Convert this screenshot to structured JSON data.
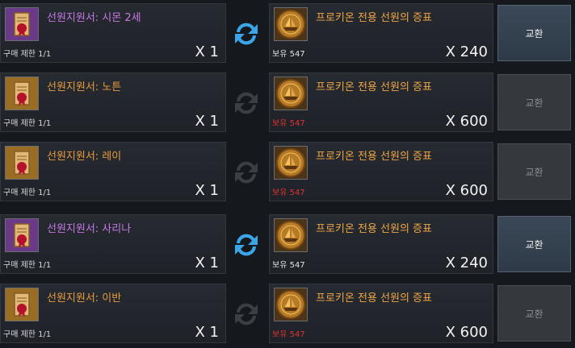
{
  "colors": {
    "purple_name": "#c678e6",
    "orange_name": "#e99b3c",
    "reward_name": "#f0a645",
    "insufficient": "#e0342e",
    "swap_active": "#3aa6e8",
    "swap_inactive": "#3a3f46"
  },
  "rows": [
    {
      "item": {
        "name": "선원지원서: 시몬 2세",
        "icon": "scroll-icon",
        "limit": "구매 제한 1/1",
        "qty": "X 1"
      },
      "swap": {
        "icon": "swap-arrows-icon",
        "active": true
      },
      "reward": {
        "name": "프로키온 전용 선원의 증표",
        "icon": "ship-coin-icon",
        "owned": "보유 547",
        "cost": "X 240",
        "sufficient": true
      },
      "button": {
        "label": "교환",
        "enabled": true
      }
    },
    {
      "item": {
        "name": "선원지원서: 노튼",
        "icon": "scroll-icon",
        "limit": "구매 제한 1/1",
        "qty": "X 1"
      },
      "swap": {
        "icon": "swap-arrows-icon",
        "active": false
      },
      "reward": {
        "name": "프로키온 전용 선원의 증표",
        "icon": "ship-coin-icon",
        "owned": "보유 547",
        "cost": "X 600",
        "sufficient": false
      },
      "button": {
        "label": "교환",
        "enabled": false
      }
    },
    {
      "item": {
        "name": "선원지원서: 레이",
        "icon": "scroll-icon",
        "limit": "구매 제한 1/1",
        "qty": "X 1"
      },
      "swap": {
        "icon": "swap-arrows-icon",
        "active": false
      },
      "reward": {
        "name": "프로키온 전용 선원의 증표",
        "icon": "ship-coin-icon",
        "owned": "보유 547",
        "cost": "X 600",
        "sufficient": false
      },
      "button": {
        "label": "교환",
        "enabled": false
      }
    },
    {
      "item": {
        "name": "선원지원서: 사리나",
        "icon": "scroll-icon",
        "limit": "구매 제한 1/1",
        "qty": "X 1"
      },
      "swap": {
        "icon": "swap-arrows-icon",
        "active": true
      },
      "reward": {
        "name": "프로키온 전용 선원의 증표",
        "icon": "ship-coin-icon",
        "owned": "보유 547",
        "cost": "X 240",
        "sufficient": true
      },
      "button": {
        "label": "교환",
        "enabled": true
      }
    },
    {
      "item": {
        "name": "선원지원서: 이반",
        "icon": "scroll-icon",
        "limit": "구매 제한 1/1",
        "qty": "X 1"
      },
      "swap": {
        "icon": "swap-arrows-icon",
        "active": false
      },
      "reward": {
        "name": "프로키온 전용 선원의 증표",
        "icon": "ship-coin-icon",
        "owned": "보유 547",
        "cost": "X 600",
        "sufficient": false
      },
      "button": {
        "label": "교환",
        "enabled": false
      }
    }
  ]
}
